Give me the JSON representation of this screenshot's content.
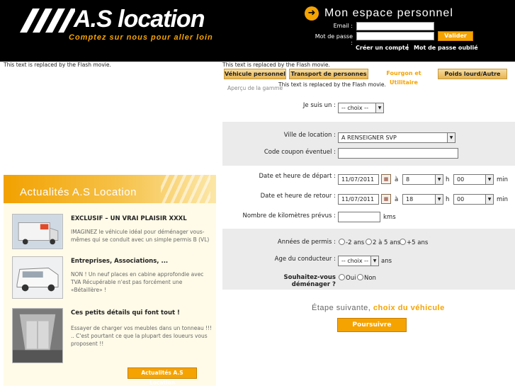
{
  "header": {
    "logo_text": "A.S location",
    "tagline": "Comptez sur nous pour aller loin",
    "espace_title": "Mon espace personnel",
    "email_label": "Email :",
    "password_label": "Mot de passe :",
    "validate_label": "Valider",
    "create_account": "Créer un compte",
    "separator": "|",
    "forgot_password": "Mot de passe oublié"
  },
  "flash_text": "This text is replaced by the Flash movie.",
  "tabs": [
    {
      "label": "Véhicule personnel"
    },
    {
      "label": "Transport de personnes"
    },
    {
      "label": "Fourgon et Utilitaire",
      "active": true
    },
    {
      "label": "Poids lourd/Autre"
    }
  ],
  "apercu": "Aperçu de la gamme",
  "form": {
    "je_suis_label": "Je suis un :",
    "je_suis_value": "-- choix --",
    "ville_label": "Ville de location :",
    "ville_value": "A RENSEIGNER SVP",
    "coupon_label": "Code coupon éventuel :",
    "coupon_value": "",
    "depart_label": "Date et heure de départ :",
    "depart_date": "11/07/2011",
    "depart_h": "8",
    "depart_min": "00",
    "retour_label": "Date et heure de retour :",
    "retour_date": "11/07/2011",
    "retour_h": "18",
    "retour_min": "00",
    "a_label": "à",
    "h_label": "h",
    "min_label": "min",
    "km_label": "Nombre de kilomètres prévus :",
    "km_value": "",
    "km_unit": "kms",
    "permis_label": "Années de permis :",
    "permis_options": [
      "-2 ans",
      "2 à 5 ans",
      "+5 ans"
    ],
    "age_label": "Age du conducteur :",
    "age_value": "-- choix --",
    "age_unit": "ans",
    "demenager_label": "Souhaitez-vous déménager ?",
    "demenager_options": [
      "Oui",
      "Non"
    ]
  },
  "next_step": {
    "prefix": "Étape suivante,",
    "highlight": "choix du véhicule",
    "button": "Poursuivre"
  },
  "actualites": {
    "title": "Actualités A.S Location",
    "items": [
      {
        "title": "EXCLUSIF – UN VRAI PLAISIR XXXL",
        "body": "IMAGINEZ le véhicule idéal pour déménager vous-mêmes qui se conduit avec un simple permis B (VL)"
      },
      {
        "title": "Entreprises, Associations, ...",
        "body": "NON ! Un neuf places en cabine approfondie avec TVA Récupérable n'est pas forcément une «Bétaillère» !"
      },
      {
        "title": "Ces petits détails qui font tout !",
        "body": "Essayer de charger vos meubles dans un tonneau !!! .. C'est pourtant ce que la plupart des loueurs vous proposent !!"
      }
    ],
    "button": "Actualités A.S Location"
  },
  "colors": {
    "accent": "#f5a300",
    "header_bg": "#000000",
    "band_bg": "#ebebeb"
  }
}
